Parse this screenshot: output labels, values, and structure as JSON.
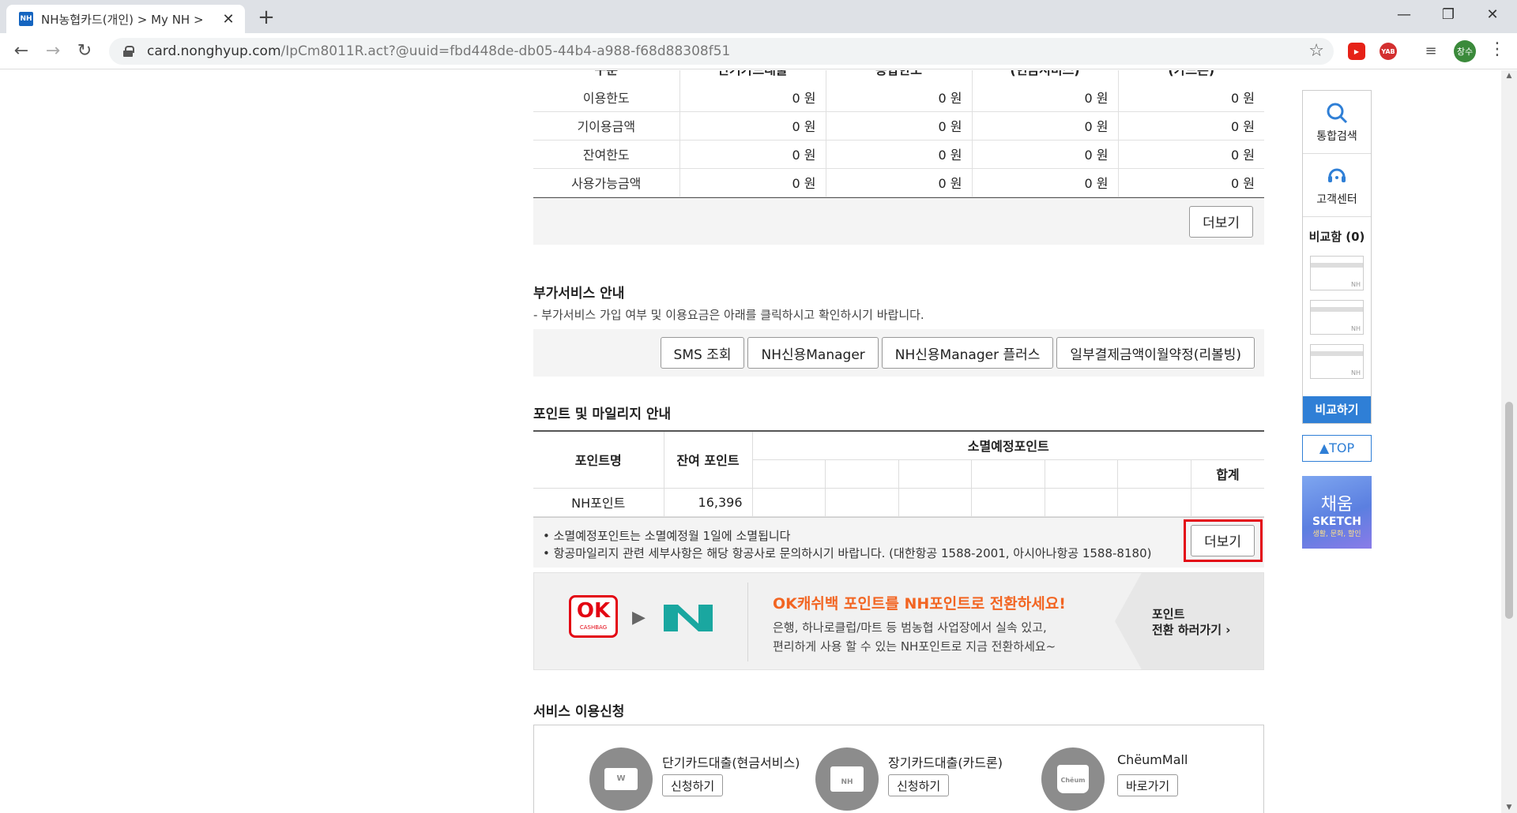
{
  "browser": {
    "tab_title": "NH농협카드(개인) > My NH > ",
    "tab_favicon": "NH",
    "new_tab": "+",
    "url_host": "card.nonghyup.com",
    "url_path": "/IpCm8011R.act?@uuid=fbd448de-db05-44b4-a988-f68d88308f51",
    "profile_initial": "창수",
    "extensions": [
      {
        "name": "youtube-ext-icon",
        "label": "▶",
        "color": "#e62117"
      },
      {
        "name": "yab-ext-icon",
        "label": "YAB",
        "color": "#d32f2f"
      }
    ]
  },
  "limit_table": {
    "headers": [
      "구분",
      "단기카드대출",
      "종합한도",
      "(현금서비스)",
      "(카드론)"
    ],
    "rows": [
      {
        "label": "이용한도",
        "values": [
          "0 원",
          "0 원",
          "0 원",
          "0 원"
        ]
      },
      {
        "label": "기이용금액",
        "values": [
          "0 원",
          "0 원",
          "0 원",
          "0 원"
        ]
      },
      {
        "label": "잔여한도",
        "values": [
          "0 원",
          "0 원",
          "0 원",
          "0 원"
        ]
      },
      {
        "label": "사용가능금액",
        "values": [
          "0 원",
          "0 원",
          "0 원",
          "0 원"
        ]
      }
    ],
    "more_label": "더보기"
  },
  "addon": {
    "title": "부가서비스 안내",
    "desc": "- 부가서비스 가입 여부 및 이용요금은 아래를 클릭하시고 확인하시기 바랍니다.",
    "buttons": [
      "SMS 조회",
      "NH신용Manager",
      "NH신용Manager 플러스",
      "일부결제금액이월약정(리볼빙)"
    ]
  },
  "points": {
    "title": "포인트 및 마일리지 안내",
    "col_name": "포인트명",
    "col_balance": "잔여 포인트",
    "col_expiring": "소멸예정포인트",
    "col_total": "합계",
    "rows": [
      {
        "name": "NH포인트",
        "balance": "16,396"
      }
    ],
    "note1": "• 소멸예정포인트는 소멸예정월 1일에 소멸됩니다",
    "note2": "• 항공마일리지 관련 세부사항은 해당 항공사로 문의하시기 바랍니다. (대한항공 1588-2001, 아시아나항공 1588-8180)",
    "more_label": "더보기"
  },
  "banner": {
    "ok_logo": "OK",
    "ok_sub": "CASHBAG",
    "headline": "OK캐쉬백 포인트를 NH포인트로 전환하세요!",
    "line1": "은행, 하나로클럽/마트 등 범농협 사업장에서 실속 있고,",
    "line2": "편리하게 사용 할 수 있는 NH포인트로 지금 전환하세요~",
    "cta1": "포인트",
    "cta2": "전환 하러가기"
  },
  "service": {
    "title": "서비스 이용신청",
    "items": [
      {
        "label": "단기카드대출(현금서비스)",
        "button": "신청하기"
      },
      {
        "label": "장기카드대출(카드론)",
        "button": "신청하기"
      },
      {
        "label": "ChёumMall",
        "button": "바로가기"
      }
    ],
    "icon_w": "W",
    "icon_nh": "NH",
    "icon_cheum": "Chёum"
  },
  "quick_menu": {
    "search_label": "통합검색",
    "cs_label": "고객센터",
    "compare_label": "비교함 (0)",
    "card_tag": "NH",
    "compare_button": "비교하기",
    "top_button": "TOP",
    "sketch_title": "채움",
    "sketch_sub": "SKETCH",
    "sketch_tag": "생활, 문화, 할인"
  },
  "colors": {
    "accent_blue": "#2f7fd6",
    "highlight_red": "#e30613",
    "banner_orange": "#f26522",
    "nh_teal": "#1aa7a0"
  }
}
